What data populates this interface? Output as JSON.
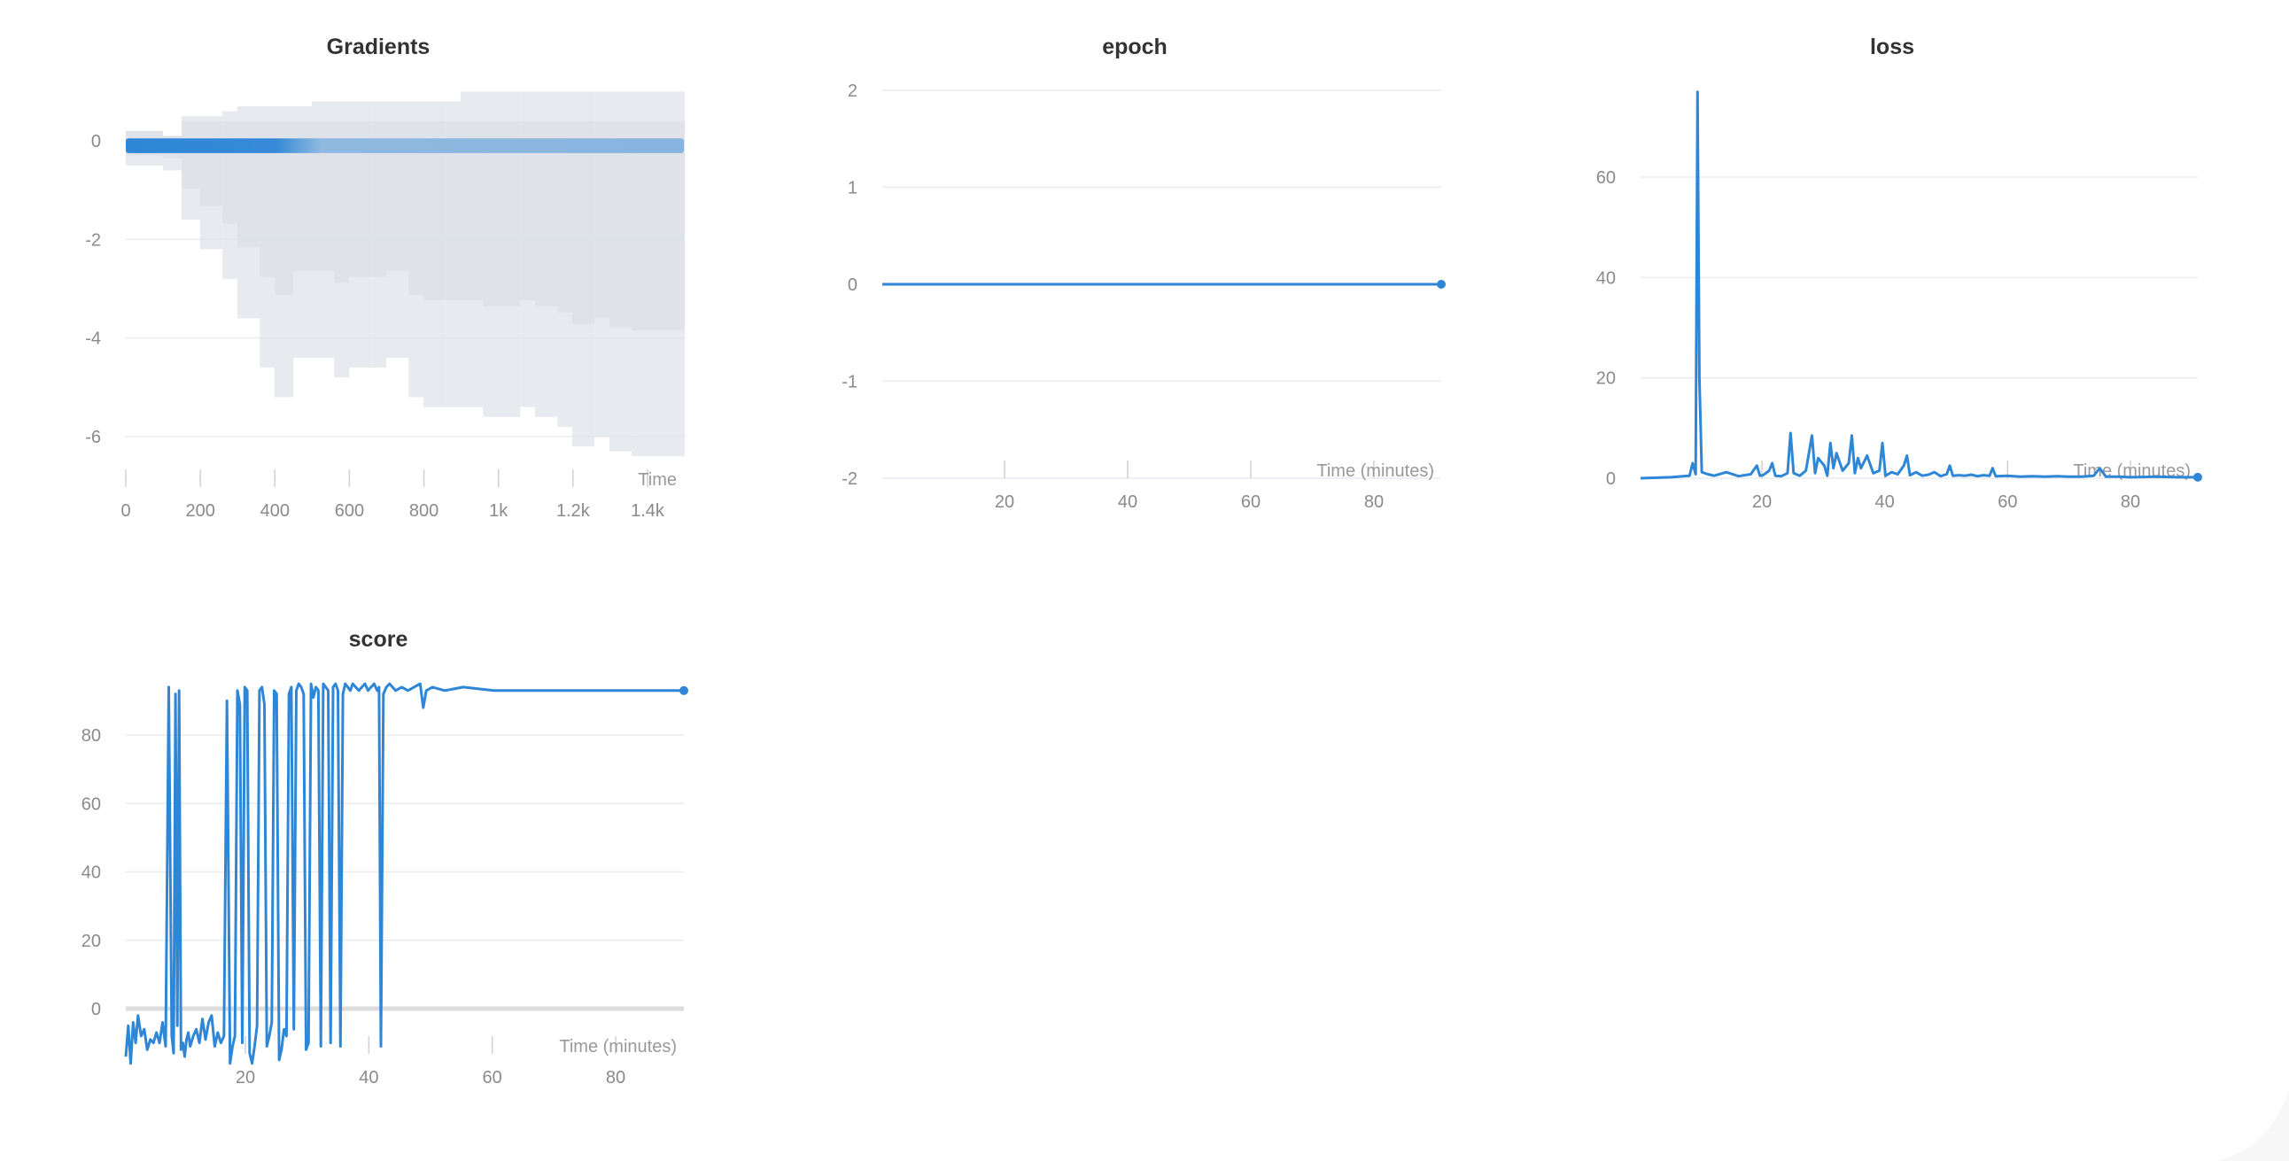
{
  "panels": {
    "gradients": {
      "title": "Gradients"
    },
    "epoch": {
      "title": "epoch"
    },
    "loss": {
      "title": "loss"
    },
    "score": {
      "title": "score"
    }
  },
  "chart_data": [
    {
      "id": "gradients",
      "type": "heatmap",
      "title": "Gradients",
      "xlabel": "Time",
      "xlim": [
        0,
        1500
      ],
      "ylim": [
        -7,
        1
      ],
      "x_ticks": [
        0,
        200,
        400,
        600,
        800,
        1000,
        1200,
        1400
      ],
      "x_tick_labels": [
        "0",
        "200",
        "400",
        "600",
        "800",
        "1k",
        "1.2k",
        "1.4k"
      ],
      "y_ticks": [
        0,
        -2,
        -4,
        -6
      ],
      "color": "#2e86d6",
      "spread_color": "#dfe3e8",
      "columns": [
        {
          "x": 0,
          "min": -0.5,
          "max": 0.2
        },
        {
          "x": 100,
          "min": -0.6,
          "max": 0.1
        },
        {
          "x": 150,
          "min": -1.6,
          "max": 0.5
        },
        {
          "x": 200,
          "min": -2.2,
          "max": 0.5
        },
        {
          "x": 260,
          "min": -2.8,
          "max": 0.6
        },
        {
          "x": 300,
          "min": -3.6,
          "max": 0.7
        },
        {
          "x": 360,
          "min": -4.6,
          "max": 0.7
        },
        {
          "x": 400,
          "min": -5.2,
          "max": 0.7
        },
        {
          "x": 450,
          "min": -4.4,
          "max": 0.7
        },
        {
          "x": 500,
          "min": -4.4,
          "max": 0.8
        },
        {
          "x": 560,
          "min": -4.8,
          "max": 0.8
        },
        {
          "x": 600,
          "min": -4.6,
          "max": 0.8
        },
        {
          "x": 660,
          "min": -4.6,
          "max": 0.8
        },
        {
          "x": 700,
          "min": -4.4,
          "max": 0.8
        },
        {
          "x": 760,
          "min": -5.2,
          "max": 0.8
        },
        {
          "x": 800,
          "min": -5.4,
          "max": 0.8
        },
        {
          "x": 860,
          "min": -5.4,
          "max": 0.8
        },
        {
          "x": 900,
          "min": -5.4,
          "max": 1.0
        },
        {
          "x": 960,
          "min": -5.6,
          "max": 1.0
        },
        {
          "x": 1000,
          "min": -5.6,
          "max": 1.0
        },
        {
          "x": 1060,
          "min": -5.4,
          "max": 1.0
        },
        {
          "x": 1100,
          "min": -5.6,
          "max": 1.0
        },
        {
          "x": 1160,
          "min": -5.8,
          "max": 1.0
        },
        {
          "x": 1200,
          "min": -6.2,
          "max": 1.0
        },
        {
          "x": 1260,
          "min": -6.0,
          "max": 1.0
        },
        {
          "x": 1300,
          "min": -6.3,
          "max": 1.0
        },
        {
          "x": 1360,
          "min": -6.4,
          "max": 1.0
        },
        {
          "x": 1400,
          "min": -6.4,
          "max": 1.0
        },
        {
          "x": 1450,
          "min": -6.4,
          "max": 1.0
        },
        {
          "x": 1500,
          "min": -6.4,
          "max": 1.0
        }
      ],
      "core": {
        "center": -0.1,
        "low": -0.25,
        "high": 0.05
      }
    },
    {
      "id": "epoch",
      "type": "line",
      "title": "epoch",
      "xlabel": "Time (minutes)",
      "xlim": [
        0,
        91
      ],
      "ylim": [
        -2,
        2
      ],
      "x_ticks": [
        20,
        40,
        60,
        80
      ],
      "y_ticks": [
        2,
        1,
        0,
        -1,
        -2
      ],
      "series": [
        {
          "x": [
            0,
            91
          ],
          "y": [
            0,
            0
          ]
        }
      ]
    },
    {
      "id": "loss",
      "type": "line",
      "title": "loss",
      "xlabel": "Time (minutes)",
      "xlim": [
        0,
        91
      ],
      "ylim": [
        0,
        77
      ],
      "x_ticks": [
        20,
        40,
        60,
        80
      ],
      "y_ticks": [
        60,
        40,
        20,
        0
      ],
      "series": [
        {
          "x": [
            0,
            5,
            8,
            8.5,
            9,
            9.3,
            9.6,
            10,
            11,
            12,
            14,
            16,
            18,
            19,
            19.5,
            20,
            21,
            21.5,
            22,
            23,
            24,
            24.5,
            25,
            26,
            27,
            28,
            28.5,
            29,
            30,
            30.5,
            31,
            31.5,
            32,
            33,
            34,
            34.5,
            35,
            35.5,
            36,
            37,
            38,
            39,
            39.5,
            40,
            41,
            42,
            43,
            43.5,
            44,
            45,
            46,
            47,
            48,
            49,
            50,
            50.5,
            51,
            52,
            53,
            54,
            55,
            56,
            57,
            57.5,
            58,
            60,
            62,
            64,
            66,
            68,
            70,
            72,
            74,
            75,
            76,
            78,
            80,
            84,
            88,
            91
          ],
          "y": [
            0,
            0.2,
            0.5,
            3,
            0.8,
            77,
            20,
            1.2,
            0.8,
            0.5,
            1.2,
            0.4,
            0.8,
            2.5,
            0.5,
            0.6,
            1.5,
            3,
            0.5,
            0.4,
            1,
            9,
            1,
            0.5,
            1.5,
            8.5,
            1,
            4,
            2.5,
            0.5,
            7,
            2,
            5,
            1.5,
            3,
            8.5,
            1,
            4,
            2,
            4.5,
            1,
            1.5,
            7,
            0.5,
            1.2,
            0.8,
            2.5,
            4.5,
            0.6,
            1.2,
            0.5,
            0.7,
            1.2,
            0.4,
            0.8,
            2.5,
            0.5,
            0.6,
            0.5,
            0.7,
            0.4,
            0.6,
            0.5,
            2,
            0.4,
            0.5,
            0.3,
            0.4,
            0.3,
            0.4,
            0.3,
            0.3,
            0.5,
            2,
            0.3,
            0.3,
            0.2,
            0.3,
            0.2,
            0.2
          ]
        }
      ]
    },
    {
      "id": "score",
      "type": "line",
      "title": "score",
      "xlabel": "Time (minutes)",
      "xlim": [
        0,
        91
      ],
      "ylim": [
        -18,
        96
      ],
      "x_ticks": [
        20,
        40,
        60,
        80
      ],
      "y_ticks": [
        80,
        60,
        40,
        20,
        0
      ],
      "series": [
        {
          "x": [
            0,
            0.4,
            0.8,
            1.2,
            1.6,
            2,
            2.5,
            3,
            3.5,
            4,
            4.5,
            5,
            5.5,
            6,
            6.5,
            7,
            7.5,
            7.8,
            8.1,
            8.4,
            8.7,
            9,
            9.3,
            9.6,
            9.9,
            10.2,
            10.5,
            11,
            11.5,
            12,
            12.5,
            13,
            13.5,
            14,
            14.5,
            15,
            15.5,
            16,
            16.5,
            17,
            17.4,
            17.8,
            18.2,
            18.6,
            19,
            19.4,
            19.8,
            20.2,
            20.6,
            21,
            21.4,
            21.8,
            22.2,
            22.6,
            23,
            23.4,
            23.8,
            24.2,
            24.6,
            25,
            25.4,
            25.8,
            26.2,
            26.6,
            27,
            27.4,
            27.8,
            28.2,
            28.6,
            29,
            29.4,
            29.8,
            30.2,
            30.6,
            31,
            31.4,
            31.8,
            32.2,
            32.6,
            33,
            33.4,
            33.8,
            34.2,
            34.6,
            35,
            35.4,
            35.8,
            36.2,
            36.6,
            37,
            37.5,
            38,
            38.5,
            39,
            39.5,
            40,
            40.5,
            41,
            41.3,
            41.6,
            42,
            42.5,
            43,
            44,
            45,
            46,
            47,
            48,
            48.5,
            49,
            50,
            52,
            55,
            60,
            70,
            80,
            91
          ],
          "y": [
            -14,
            -5,
            -16,
            -4,
            -10,
            -2,
            -8,
            -6,
            -12,
            -9,
            -10,
            -7,
            -10,
            -4,
            -11,
            94,
            -8,
            -13,
            92,
            -5,
            93,
            -12,
            -10,
            -14,
            -9,
            -7,
            -11,
            -8,
            -6,
            -10,
            -3,
            -9,
            -4,
            -2,
            -11,
            -7,
            -10,
            -8,
            90,
            -16,
            -11,
            -8,
            93,
            89,
            -10,
            94,
            93,
            -13,
            -16,
            -11,
            -5,
            93,
            94,
            89,
            -11,
            -8,
            -4,
            93,
            92,
            -15,
            -12,
            -6,
            -8,
            92,
            94,
            -6,
            93,
            95,
            94,
            92,
            -12,
            -10,
            95,
            91,
            94,
            93,
            -11,
            95,
            94,
            93,
            -10,
            94,
            95,
            93,
            -11,
            92,
            95,
            94,
            93,
            95,
            94,
            93,
            94,
            95,
            93,
            94,
            95,
            93,
            94,
            -11,
            92,
            94,
            95,
            93,
            94,
            93,
            94,
            95,
            88,
            93,
            94,
            93,
            94,
            93,
            93,
            93,
            93
          ]
        }
      ]
    }
  ]
}
